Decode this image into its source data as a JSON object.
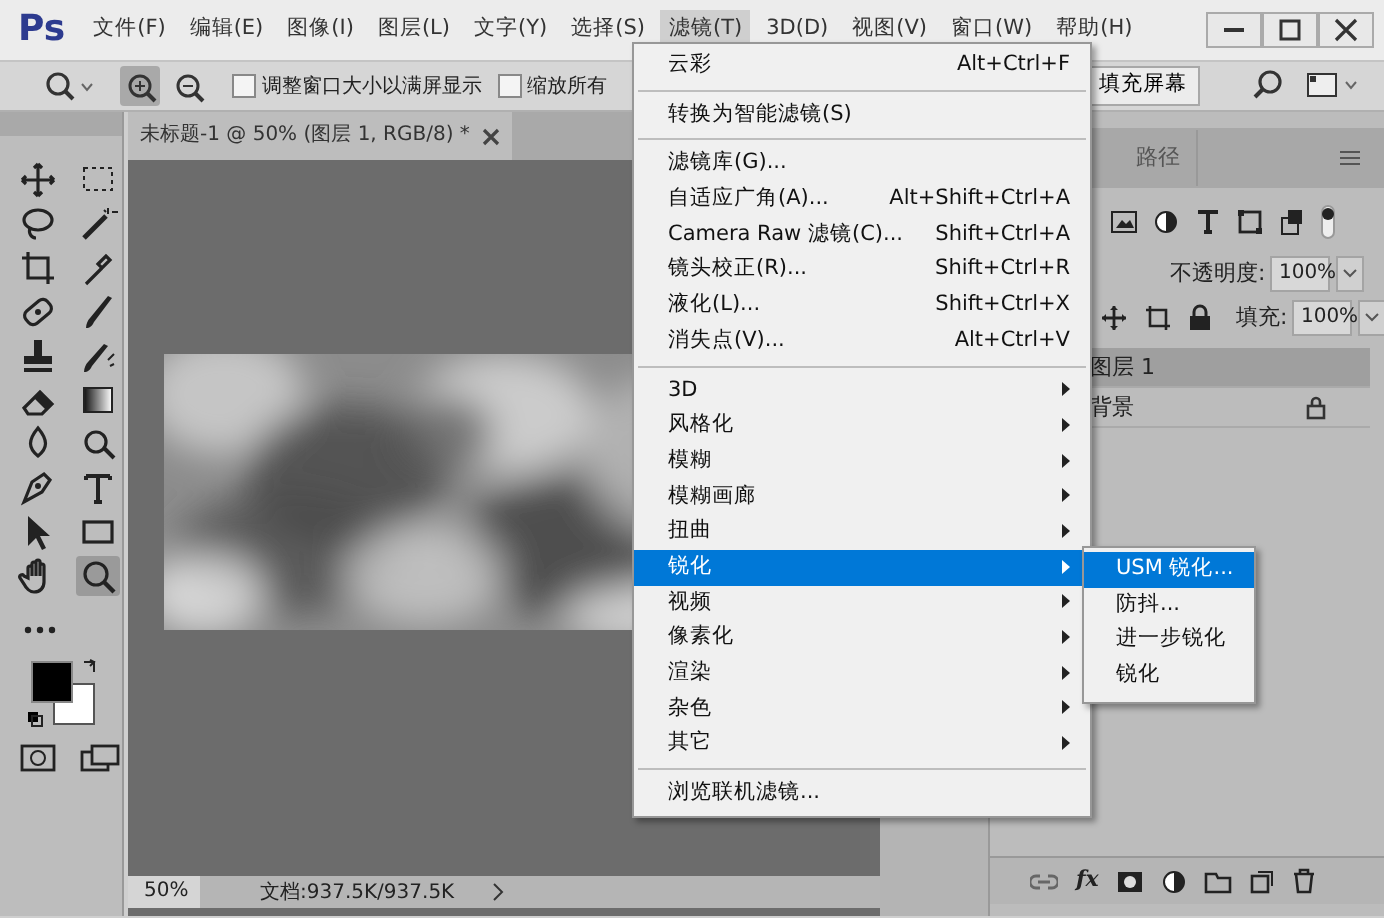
{
  "app_logo": "Ps",
  "menu_bar": [
    {
      "label": "文件(F)",
      "selected": false
    },
    {
      "label": "编辑(E)",
      "selected": false
    },
    {
      "label": "图像(I)",
      "selected": false
    },
    {
      "label": "图层(L)",
      "selected": false
    },
    {
      "label": "文字(Y)",
      "selected": false
    },
    {
      "label": "选择(S)",
      "selected": false
    },
    {
      "label": "滤镜(T)",
      "selected": true
    },
    {
      "label": "3D(D)",
      "selected": false
    },
    {
      "label": "视图(V)",
      "selected": false
    },
    {
      "label": "窗口(W)",
      "selected": false
    },
    {
      "label": "帮助(H)",
      "selected": false
    }
  ],
  "options_bar": {
    "zoom_modes": [
      {
        "selected": true
      },
      {
        "selected": false
      }
    ],
    "checkboxes": [
      {
        "label": "调整窗口大小以满屏显示",
        "checked": false
      },
      {
        "label": "缩放所有",
        "checked": false
      }
    ],
    "fill_screen_button": "填充屏幕"
  },
  "tools": [
    {
      "selected": false
    },
    {
      "selected": false
    },
    {
      "selected": false
    },
    {
      "selected": false
    },
    {
      "selected": false
    },
    {
      "selected": false
    },
    {
      "selected": false
    },
    {
      "selected": false
    },
    {
      "selected": false
    },
    {
      "selected": false
    },
    {
      "selected": false
    },
    {
      "selected": false
    },
    {
      "selected": false
    },
    {
      "selected": false
    },
    {
      "selected": false
    },
    {
      "selected": false
    },
    {
      "selected": false
    },
    {
      "selected": false
    },
    {
      "selected": false
    },
    {
      "selected": true
    }
  ],
  "document": {
    "tab_title": "未标题-1 @ 50% (图层 1, RGB/8) *",
    "zoom": "50%",
    "doc_info": "文档:937.5K/937.5K"
  },
  "filter_menu": [
    [
      {
        "label": "云彩",
        "shortcut": "Alt+Ctrl+F",
        "submenu": false,
        "selected": false
      }
    ],
    [
      {
        "label": "转换为智能滤镜(S)",
        "submenu": false,
        "selected": false
      }
    ],
    [
      {
        "label": "滤镜库(G)...",
        "submenu": false,
        "selected": false
      },
      {
        "label": "自适应广角(A)...",
        "shortcut": "Alt+Shift+Ctrl+A",
        "submenu": false,
        "selected": false
      },
      {
        "label": "Camera Raw 滤镜(C)...",
        "shortcut": "Shift+Ctrl+A",
        "submenu": false,
        "selected": false
      },
      {
        "label": "镜头校正(R)...",
        "shortcut": "Shift+Ctrl+R",
        "submenu": false,
        "selected": false
      },
      {
        "label": "液化(L)...",
        "shortcut": "Shift+Ctrl+X",
        "submenu": false,
        "selected": false
      },
      {
        "label": "消失点(V)...",
        "shortcut": "Alt+Ctrl+V",
        "submenu": false,
        "selected": false
      }
    ],
    [
      {
        "label": "3D",
        "submenu": true,
        "selected": false
      },
      {
        "label": "风格化",
        "submenu": true,
        "selected": false
      },
      {
        "label": "模糊",
        "submenu": true,
        "selected": false
      },
      {
        "label": "模糊画廊",
        "submenu": true,
        "selected": false
      },
      {
        "label": "扭曲",
        "submenu": true,
        "selected": false
      },
      {
        "label": "锐化",
        "submenu": true,
        "selected": true
      },
      {
        "label": "视频",
        "submenu": true,
        "selected": false
      },
      {
        "label": "像素化",
        "submenu": true,
        "selected": false
      },
      {
        "label": "渲染",
        "submenu": true,
        "selected": false
      },
      {
        "label": "杂色",
        "submenu": true,
        "selected": false
      },
      {
        "label": "其它",
        "submenu": true,
        "selected": false
      }
    ],
    [
      {
        "label": "浏览联机滤镜...",
        "submenu": false,
        "selected": false
      }
    ]
  ],
  "submenu": [
    {
      "label": "USM 锐化...",
      "selected": true
    },
    {
      "label": "防抖...",
      "selected": false
    },
    {
      "label": "进一步锐化",
      "selected": false
    },
    {
      "label": "锐化",
      "selected": false
    }
  ],
  "layers_panel": {
    "tab": "路径",
    "opacity_label": "不透明度:",
    "opacity": "100%",
    "fill_label": "填充:",
    "fill": "100%",
    "layers": [
      {
        "name": "图层 1",
        "selected": true,
        "locked": false
      },
      {
        "name": "背景",
        "selected": false,
        "locked": true
      }
    ],
    "fx_button": "fx"
  }
}
